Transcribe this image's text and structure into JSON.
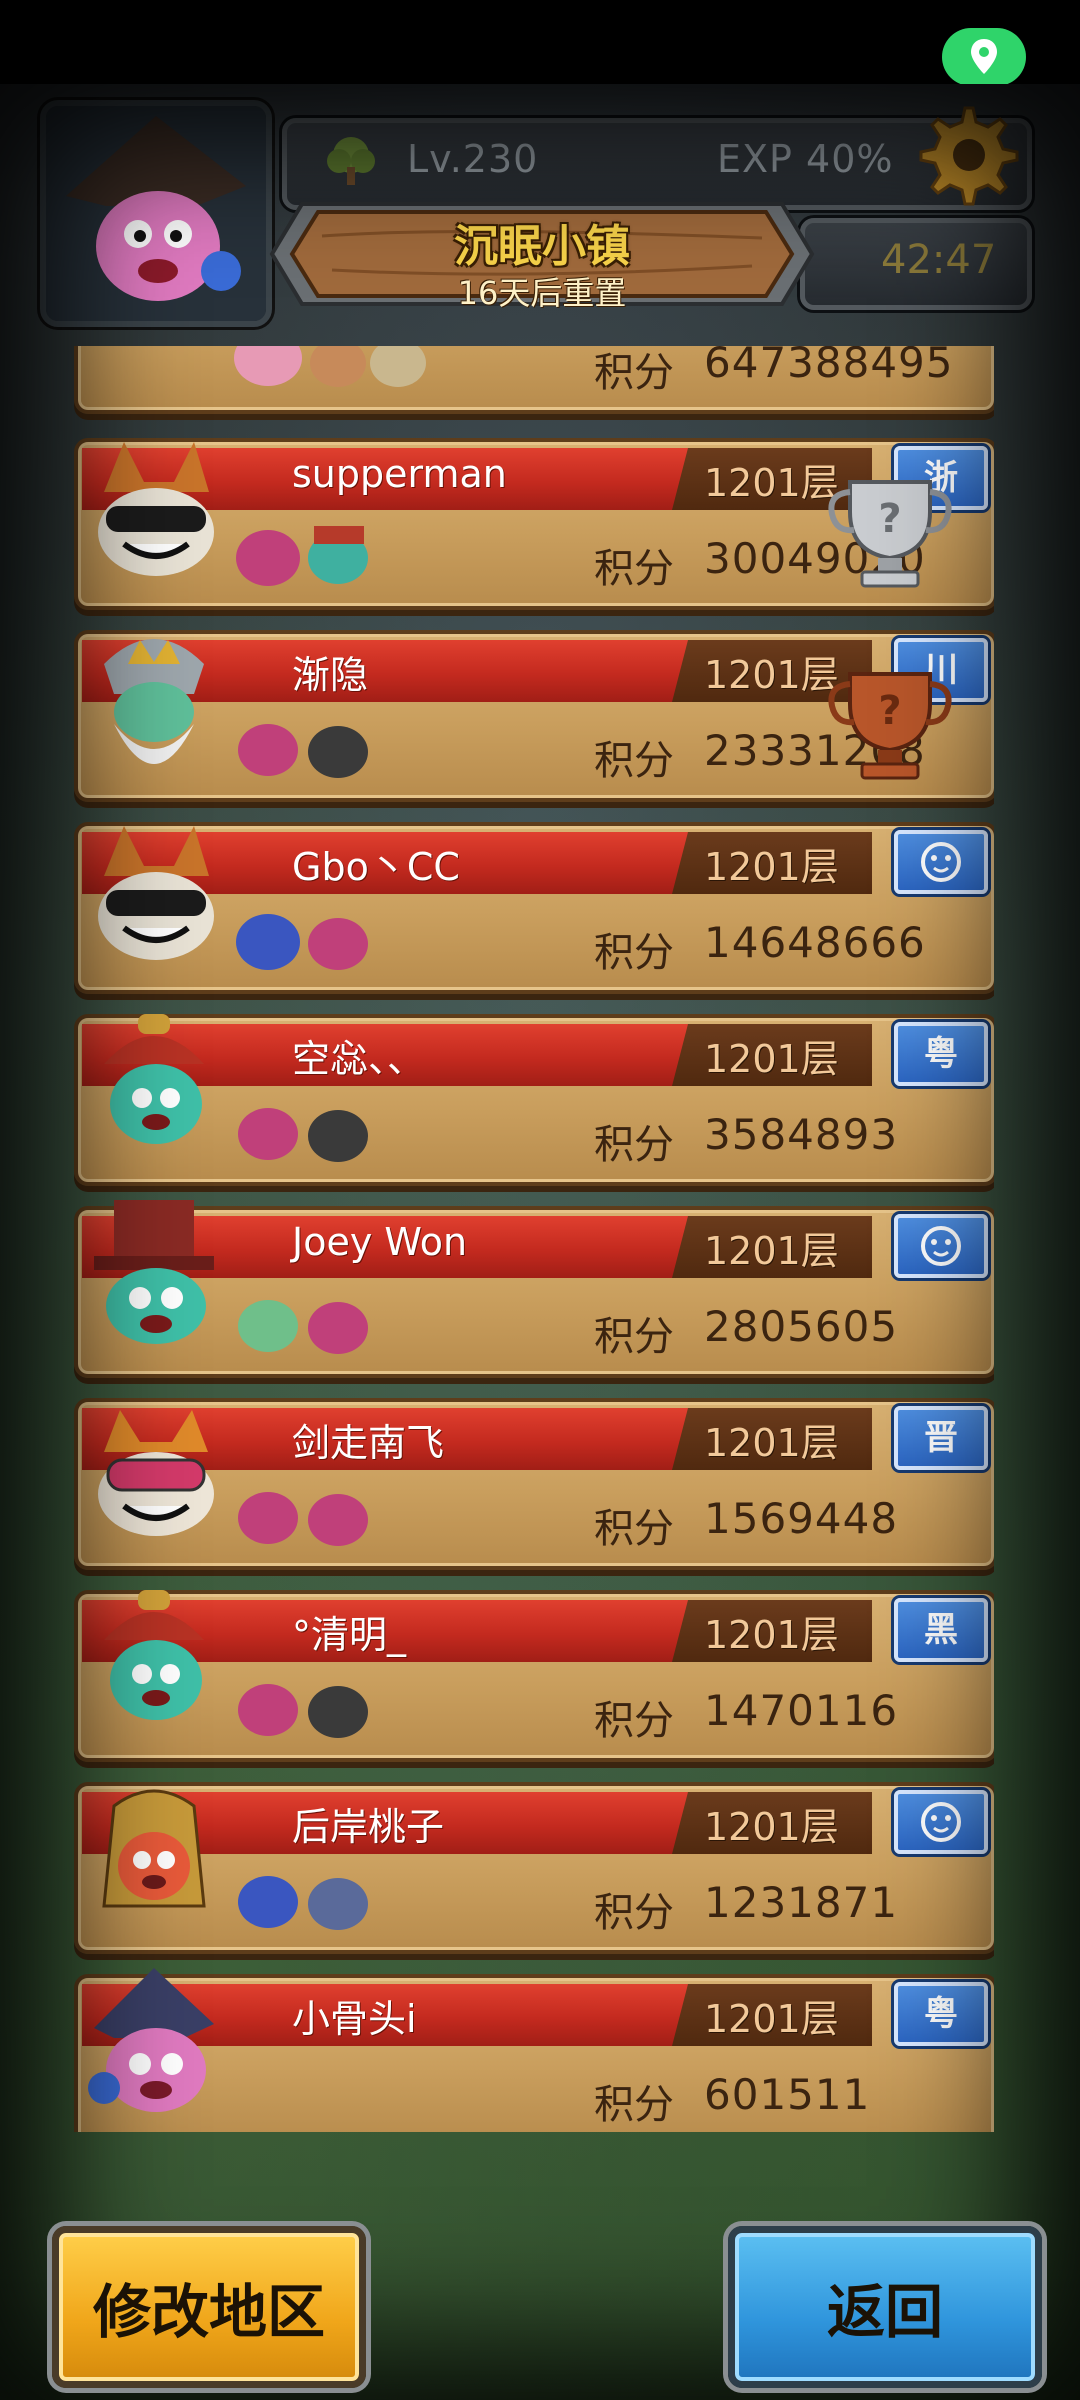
{
  "hud": {
    "level": "Lv.230",
    "exp": "EXP 40%",
    "timer": "42:47",
    "event_title": "沉眠小镇",
    "event_subtitle": "16天后重置"
  },
  "leaderboard": {
    "partial_top": {
      "score_label": "积分",
      "score": "647388495"
    },
    "entries": [
      {
        "name": "supperman",
        "floor": "1201层",
        "region": "浙",
        "score_label": "积分",
        "score": "30049020",
        "trophy": "silver"
      },
      {
        "name": "渐隐",
        "floor": "1201层",
        "region": "川",
        "score_label": "积分",
        "score": "23331208",
        "trophy": "bronze"
      },
      {
        "name": "Gbo丶CC",
        "floor": "1201层",
        "region": "",
        "region_icon": "face-icon",
        "score_label": "积分",
        "score": "14648666"
      },
      {
        "name": "空惢、、",
        "floor": "1201层",
        "region": "粤",
        "score_label": "积分",
        "score": "3584893"
      },
      {
        "name": "Joey Won",
        "floor": "1201层",
        "region": "",
        "region_icon": "face-icon",
        "score_label": "积分",
        "score": "2805605"
      },
      {
        "name": "剑走南飞",
        "floor": "1201层",
        "region": "晋",
        "score_label": "积分",
        "score": "1569448"
      },
      {
        "name": "°清明_",
        "floor": "1201层",
        "region": "黑",
        "score_label": "积分",
        "score": "1470116"
      },
      {
        "name": "后岸桃子",
        "floor": "1201层",
        "region": "",
        "region_icon": "face-icon",
        "score_label": "积分",
        "score": "1231871"
      },
      {
        "name": "小骨头i",
        "floor": "1201层",
        "region": "粤",
        "score_label": "积分",
        "score": "601511"
      }
    ]
  },
  "buttons": {
    "change_region": "修改地区",
    "back": "返回"
  },
  "colors": {
    "ribbon_red": "#c42a1f",
    "card_tan": "#c99e5d",
    "region_blue": "#2c66c2",
    "button_yellow": "#f0a61a",
    "button_blue": "#2f95dc",
    "location_green": "#2fd46a"
  }
}
